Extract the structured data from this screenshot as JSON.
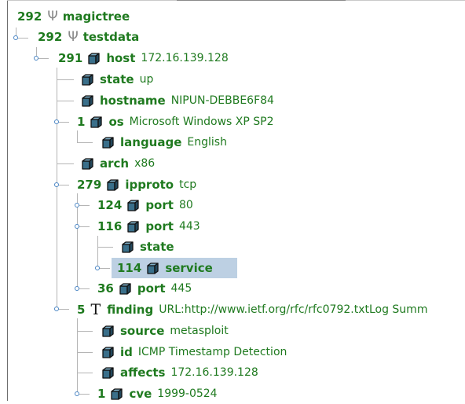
{
  "tree": {
    "root": {
      "count": "292",
      "name": "magictree"
    },
    "testdata": {
      "count": "292",
      "name": "testdata"
    },
    "host": {
      "count": "291",
      "name": "host",
      "value": "172.16.139.128"
    },
    "host_state": {
      "name": "state",
      "value": "up"
    },
    "hostname": {
      "name": "hostname",
      "value": "NIPUN-DEBBE6F84"
    },
    "os": {
      "count": "1",
      "name": "os",
      "value": "Microsoft Windows XP SP2"
    },
    "language": {
      "name": "language",
      "value": "English"
    },
    "arch": {
      "name": "arch",
      "value": "x86"
    },
    "ipproto": {
      "count": "279",
      "name": "ipproto",
      "value": "tcp"
    },
    "port80": {
      "count": "124",
      "name": "port",
      "value": "80"
    },
    "port443": {
      "count": "116",
      "name": "port",
      "value": "443"
    },
    "port443_state": {
      "name": "state"
    },
    "service": {
      "count": "114",
      "name": "service"
    },
    "port445": {
      "count": "36",
      "name": "port",
      "value": "445"
    },
    "finding": {
      "count": "5",
      "name": "finding",
      "value": "URL:http://www.ietf.org/rfc/rfc0792.txtLog  Summ"
    },
    "source": {
      "name": "source",
      "value": "metasploit"
    },
    "id": {
      "name": "id",
      "value": "ICMP Timestamp Detection"
    },
    "affects": {
      "name": "affects",
      "value": "172.16.139.128"
    },
    "cve": {
      "count": "1",
      "name": "cve",
      "value": "1999-0524"
    }
  },
  "icons": {
    "root": "trident-icon",
    "node": "cube-icon",
    "text_node": "text-t-icon",
    "expand_handle": "tree-expand-handle-icon"
  },
  "colors": {
    "label": "#1f7a1f",
    "selection": "#bdd0e3",
    "handle": "#4a86c5",
    "cube_face": "#3a6f8a",
    "connector": "#b5b5b5"
  },
  "selected": "service"
}
